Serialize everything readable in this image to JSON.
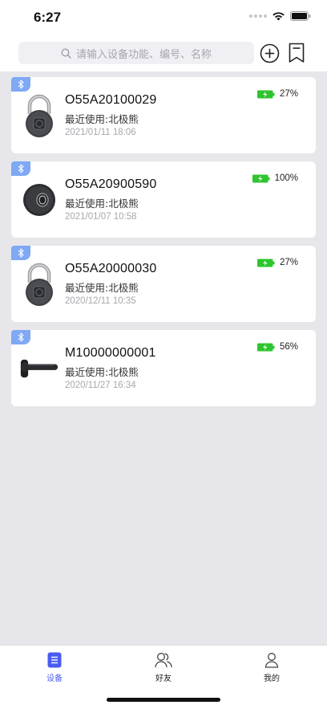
{
  "status_bar": {
    "time": "6:27"
  },
  "search": {
    "placeholder": "请输入设备功能、编号、名称"
  },
  "devices": [
    {
      "id": "O55A20100029",
      "recent": "最近使用:北极熊",
      "time": "2021/01/11 18:06",
      "battery": "27%",
      "image": "padlock-icon"
    },
    {
      "id": "O55A20900590",
      "recent": "最近使用:北极熊",
      "time": "2021/01/07 10:58",
      "battery": "100%",
      "image": "round-lock-icon"
    },
    {
      "id": "O55A20000030",
      "recent": "最近使用:北极熊",
      "time": "2020/12/11 10:35",
      "battery": "27%",
      "image": "padlock-icon"
    },
    {
      "id": "M10000000001",
      "recent": "最近使用:北极熊",
      "time": "2020/11/27 16:34",
      "battery": "56%",
      "image": "door-handle-lock-icon"
    }
  ],
  "tabs": [
    {
      "label": "设备",
      "active": true,
      "icon": "devices-icon"
    },
    {
      "label": "好友",
      "active": false,
      "icon": "friends-icon"
    },
    {
      "label": "我的",
      "active": false,
      "icon": "profile-icon"
    }
  ],
  "colors": {
    "accent": "#4a5cf0",
    "bluetooth_tag": "#7fa8f5",
    "battery_green": "#2ec52e",
    "background": "#e6e6eb"
  }
}
